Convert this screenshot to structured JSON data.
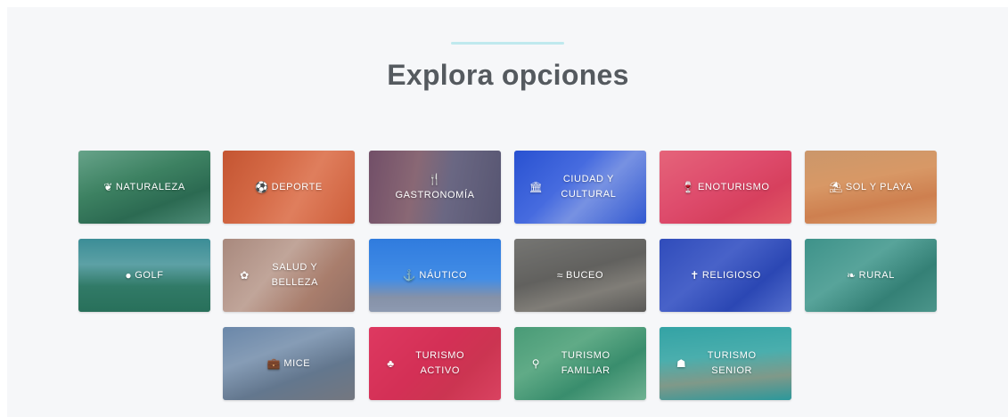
{
  "section": {
    "title": "Explora opciones"
  },
  "tiles": [
    {
      "label": "Naturaleza",
      "icon": "leaf-icon",
      "glyph": "❦",
      "tint": "rgba(40,120,110,0.45)",
      "photo": "linear-gradient(160deg,#9bc7a0 0%,#4f8a58 40%,#2f5f3a 70%,#6c9b7e 100%)"
    },
    {
      "label": "Deporte",
      "icon": "football-icon",
      "glyph": "⚽",
      "tint": "rgba(210,85,55,0.55)",
      "photo": "linear-gradient(120deg,#b3542c 0%,#d9835a 35%,#f0b08c 60%,#c8673e 100%)"
    },
    {
      "label": "Gastronomía",
      "icon": "cutlery-icon",
      "glyph": "🍴",
      "tint": "rgba(85,60,90,0.45)",
      "photo": "linear-gradient(100deg,#8a5f73 0%,#b58c8a 35%,#7c8ba4 60%,#5a6b84 100%)"
    },
    {
      "label": "Ciudad y cultural",
      "icon": "museum-icon",
      "glyph": "🏛",
      "tint": "rgba(40,80,210,0.55)",
      "photo": "linear-gradient(135deg,#2a53d0 0%,#6c8df0 40%,#d7e1f7 60%,#3f63cf 100%)"
    },
    {
      "label": "Enoturismo",
      "icon": "wine-glass-icon",
      "glyph": "🍷",
      "tint": "rgba(225,70,105,0.55)",
      "photo": "linear-gradient(150deg,#e98a8e 0%,#d9536f 45%,#c93a4f 70%,#e0705f 100%)"
    },
    {
      "label": "Sol y playa",
      "icon": "beach-umbrella-icon",
      "glyph": "⛱",
      "tint": "rgba(205,130,80,0.45)",
      "photo": "linear-gradient(170deg,#caa882 0%,#e2a978 40%,#cf7d4f 70%,#e7b283 100%)"
    },
    {
      "label": "Golf",
      "icon": "golf-ball-icon",
      "glyph": "●",
      "tint": "rgba(35,120,120,0.45)",
      "photo": "linear-gradient(180deg,#4f9fb0 0%,#8cc3cb 35%,#3d7d5a 65%,#2d6a43 100%)"
    },
    {
      "label": "Salud y belleza",
      "icon": "lotus-icon",
      "glyph": "✿",
      "tint": "rgba(150,110,100,0.45)",
      "photo": "linear-gradient(130deg,#b79e92 0%,#e3d2c6 40%,#b88a74 70%,#8d6e63 100%)"
    },
    {
      "label": "Náutico",
      "icon": "anchor-icon",
      "glyph": "⚓",
      "tint": "rgba(50,120,220,0.45)",
      "photo": "linear-gradient(180deg,#2e7fe0 0%,#4f9ff0 55%,#c9a77e 80%,#d8b68e 100%)"
    },
    {
      "label": "Buceo",
      "icon": "swimmer-icon",
      "glyph": "≈",
      "tint": "rgba(80,80,80,0.35)",
      "photo": "linear-gradient(165deg,#8a8a86 0%,#6b6a66 45%,#9a968d 70%,#5f5e5b 100%)"
    },
    {
      "label": "Religioso",
      "icon": "cross-icon",
      "glyph": "✝",
      "tint": "rgba(40,70,190,0.55)",
      "photo": "linear-gradient(140deg,#3a55b8 0%,#7086d6 40%,#2f4aa8 70%,#8aa0e0 100%)"
    },
    {
      "label": "Rural",
      "icon": "leaf-icon",
      "glyph": "❧",
      "tint": "rgba(45,130,120,0.5)",
      "photo": "linear-gradient(145deg,#4ea39c 0%,#82c6bd 40%,#3b7f74 70%,#6aa99e 100%)"
    },
    {
      "label": "Mice",
      "icon": "briefcase-icon",
      "glyph": "💼",
      "tint": "rgba(60,90,130,0.4)",
      "photo": "linear-gradient(160deg,#8aa6c4 0%,#b8c9d9 35%,#7d8a96 65%,#9a8a7e 100%)"
    },
    {
      "label": "Turismo activo",
      "icon": "hiker-group-icon",
      "glyph": "♣",
      "tint": "rgba(220,50,90,0.55)",
      "photo": "linear-gradient(135deg,#e0426a 0%,#c92f52 45%,#b73a48 70%,#d6586a 100%)"
    },
    {
      "label": "Turismo familiar",
      "icon": "family-icon",
      "glyph": "⚲",
      "tint": "rgba(50,140,110,0.45)",
      "photo": "linear-gradient(150deg,#5ba77d 0%,#86c59b 35%,#3f8f6c 65%,#a3d2b0 100%)"
    },
    {
      "label": "Turismo senior",
      "icon": "senior-couple-icon",
      "glyph": "☗",
      "tint": "rgba(40,150,150,0.5)",
      "photo": "linear-gradient(175deg,#3fb0b4 0%,#6dc7c5 40%,#d89c7c 70%,#2f9aa0 100%)"
    }
  ]
}
